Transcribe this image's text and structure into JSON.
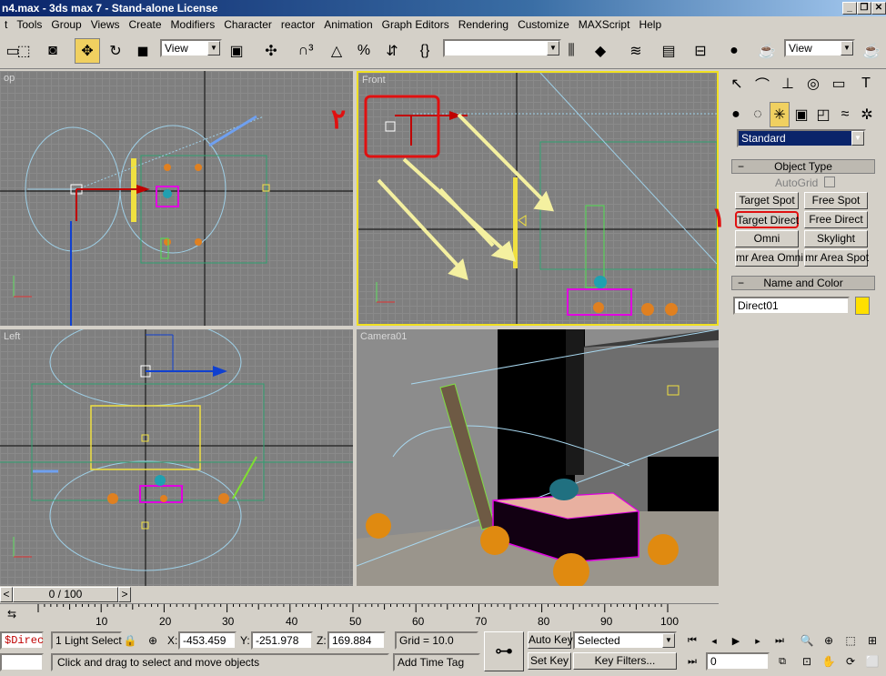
{
  "title": "n4.max - 3ds max 7  - Stand-alone License",
  "menu": [
    "t",
    "Tools",
    "Group",
    "Views",
    "Create",
    "Modifiers",
    "Character",
    "reactor",
    "Animation",
    "Graph Editors",
    "Rendering",
    "Customize",
    "MAXScript",
    "Help"
  ],
  "toolbar": {
    "ref_coord": "View",
    "named_sel": "",
    "view_right": "View"
  },
  "viewports": {
    "top": "op",
    "front": "Front",
    "left": "Left",
    "camera": "Camera01"
  },
  "annotations": {
    "one": "١",
    "two": "٢"
  },
  "cmd": {
    "category": "Standard",
    "object_type_header": "Object Type",
    "autogrid": "AutoGrid",
    "buttons": [
      "Target Spot",
      "Free Spot",
      "Target Direct",
      "Free Direct",
      "Omni",
      "Skylight",
      "mr Area Omni",
      "mr Area Spot"
    ],
    "name_color_header": "Name and Color",
    "name": "Direct01",
    "color": "#ffe000"
  },
  "time": {
    "slider": "0 / 100",
    "ticks": [
      "10",
      "20",
      "30",
      "40",
      "50",
      "60",
      "70",
      "80",
      "90",
      "100"
    ]
  },
  "status": {
    "listener": "$Direc",
    "selection": "1 Light Select",
    "x_label": "X:",
    "x": "-453.459",
    "y_label": "Y:",
    "y": "-251.978",
    "z_label": "Z:",
    "z": "169.884",
    "grid": "Grid = 10.0",
    "auto_key": "Auto Key",
    "selected": "Selected",
    "set_key": "Set Key",
    "key_filters": "Key Filters...",
    "frame": "0",
    "prompt": "Click and drag to select and move objects",
    "add_time_tag": "Add Time Tag"
  }
}
